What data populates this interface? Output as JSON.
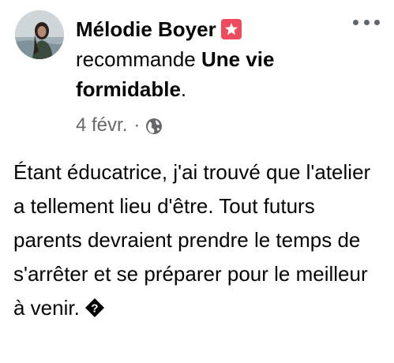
{
  "post": {
    "author": "Mélodie Boyer",
    "badge_icon": "star-badge-icon",
    "badge_color": "#ef4b5f",
    "action": "recommande",
    "page_name": "Une vie formidable",
    "page_suffix": ".",
    "timestamp": "4 févr.",
    "separator": "·",
    "audience_icon": "globe-icon",
    "more_icon": "more-options-icon",
    "text": "Étant éducatrice, j'ai trouvé que l'atelier a tellement lieu d'être. Tout futurs parents devraient prendre le temps de s'arrêter et se préparer pour le meilleur à venir.",
    "trailing_icon": "unknown-emoji-icon"
  },
  "colors": {
    "text": "#050505",
    "secondary": "#65676b",
    "badge": "#ef4b5f"
  }
}
